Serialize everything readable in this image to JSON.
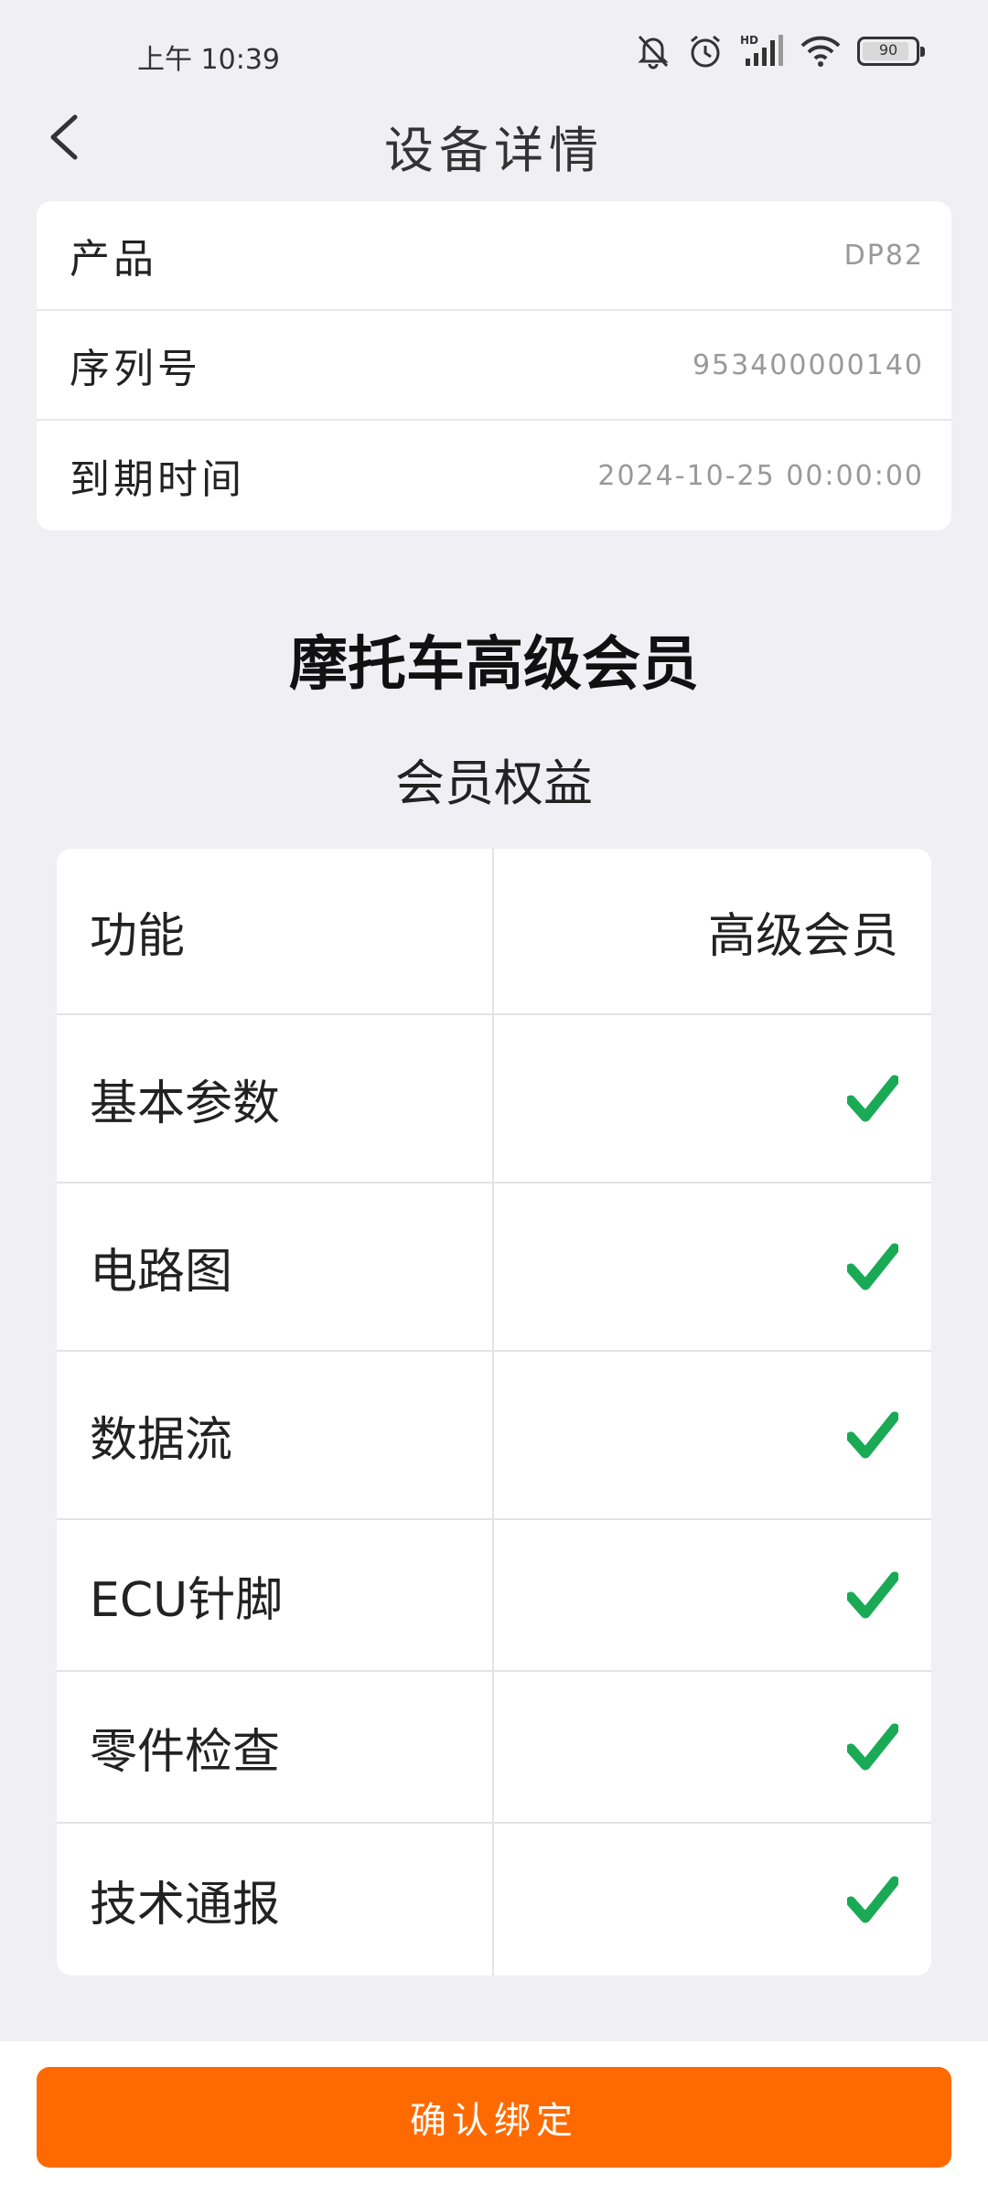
{
  "status": {
    "time": "上午 10:39",
    "battery_level": 90,
    "battery_text": "90",
    "icons": [
      "mute-bell-icon",
      "alarm-icon",
      "signal-hd-icon",
      "wifi-icon",
      "battery-icon"
    ]
  },
  "header": {
    "title": "设备详情",
    "back_icon": "chevron-left-icon"
  },
  "device_info": {
    "rows": [
      {
        "label": "产品",
        "value": "DP82"
      },
      {
        "label": "序列号",
        "value": "953400000140"
      },
      {
        "label": "到期时间",
        "value": "2024-10-25 00:00:00"
      }
    ]
  },
  "membership": {
    "title": "摩托车高级会员",
    "benefits_title": "会员权益",
    "table": {
      "header": {
        "left": "功能",
        "right": "高级会员"
      },
      "rows": [
        {
          "feature": "基本参数",
          "included": true
        },
        {
          "feature": "电路图",
          "included": true
        },
        {
          "feature": "数据流",
          "included": true
        },
        {
          "feature": "ECU针脚",
          "included": true
        },
        {
          "feature": "零件检查",
          "included": true
        },
        {
          "feature": "技术通报",
          "included": true
        }
      ]
    },
    "check_color": "#1aaa55"
  },
  "footer": {
    "confirm_label": "确认绑定",
    "button_color": "#ff6a00"
  }
}
